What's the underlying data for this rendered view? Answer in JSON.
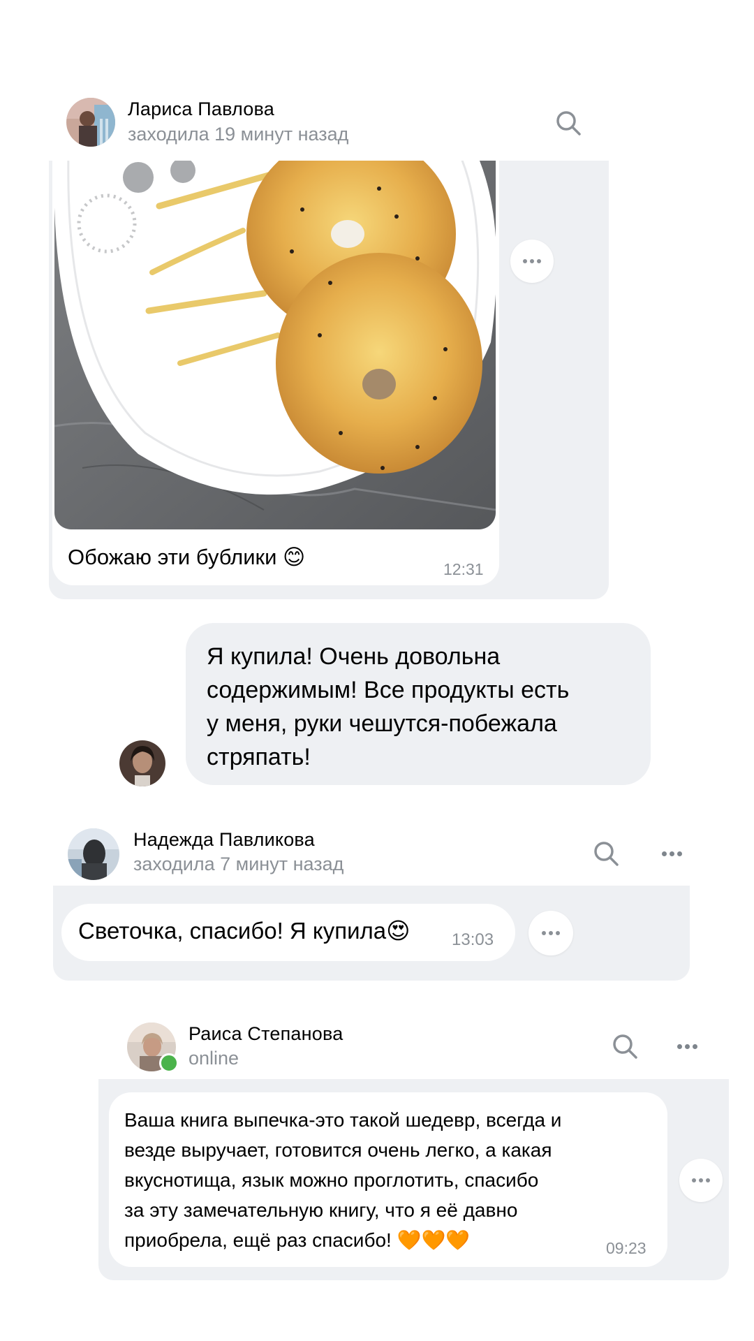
{
  "posts": [
    {
      "author": "Лариса Павлова",
      "status": "заходила 19 минут назад",
      "message": "Обожаю эти бублики 😊",
      "time": "12:31",
      "icons": [
        "search-icon",
        "more-icon"
      ]
    },
    {
      "message_lines": [
        "Я купила! Очень довольна",
        "содержимым! Все продукты есть",
        "у меня, руки чешутся-побежала",
        "стряпать!"
      ]
    },
    {
      "author": "Надежда Павликова",
      "status": "заходила 7 минут назад",
      "message": "Светочка, спасибо! Я купила😍",
      "time": "13:03",
      "icons": [
        "search-icon",
        "more-icon"
      ]
    },
    {
      "author": "Раиса Степанова",
      "status": "online",
      "message_lines": [
        "Ваша книга выпечка-это такой шедевр, всегда и",
        "везде выручает, готовится очень легко, а какая",
        "вкуснотища, язык можно проглотить, спасибо",
        "за эту замечательную книгу, что я её давно",
        "приобрела, ещё раз спасибо! 🧡🧡🧡"
      ],
      "time": "09:23",
      "icons": [
        "search-icon",
        "more-icon"
      ]
    }
  ],
  "colors": {
    "panel": "#eef0f3",
    "secondary_text": "#8b9096",
    "online": "#4bb34b",
    "heart": "#ff6a2b"
  }
}
